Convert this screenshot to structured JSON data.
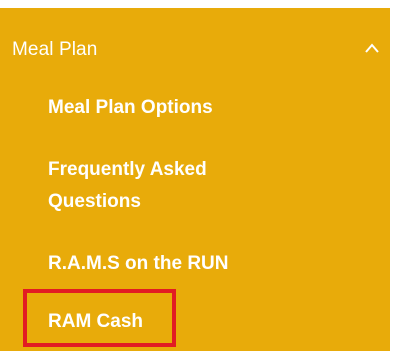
{
  "menu": {
    "title": "Meal Plan",
    "expanded_icon": "chevron-up-icon",
    "background_color": "#e8ab0a",
    "text_color": "#ffffff",
    "highlight_color": "#e21b23",
    "items": [
      {
        "label": "Meal Plan Options"
      },
      {
        "label": "Frequently Asked Questions"
      },
      {
        "label": "R.A.M.S on the RUN"
      },
      {
        "label": "RAM Cash"
      }
    ]
  }
}
